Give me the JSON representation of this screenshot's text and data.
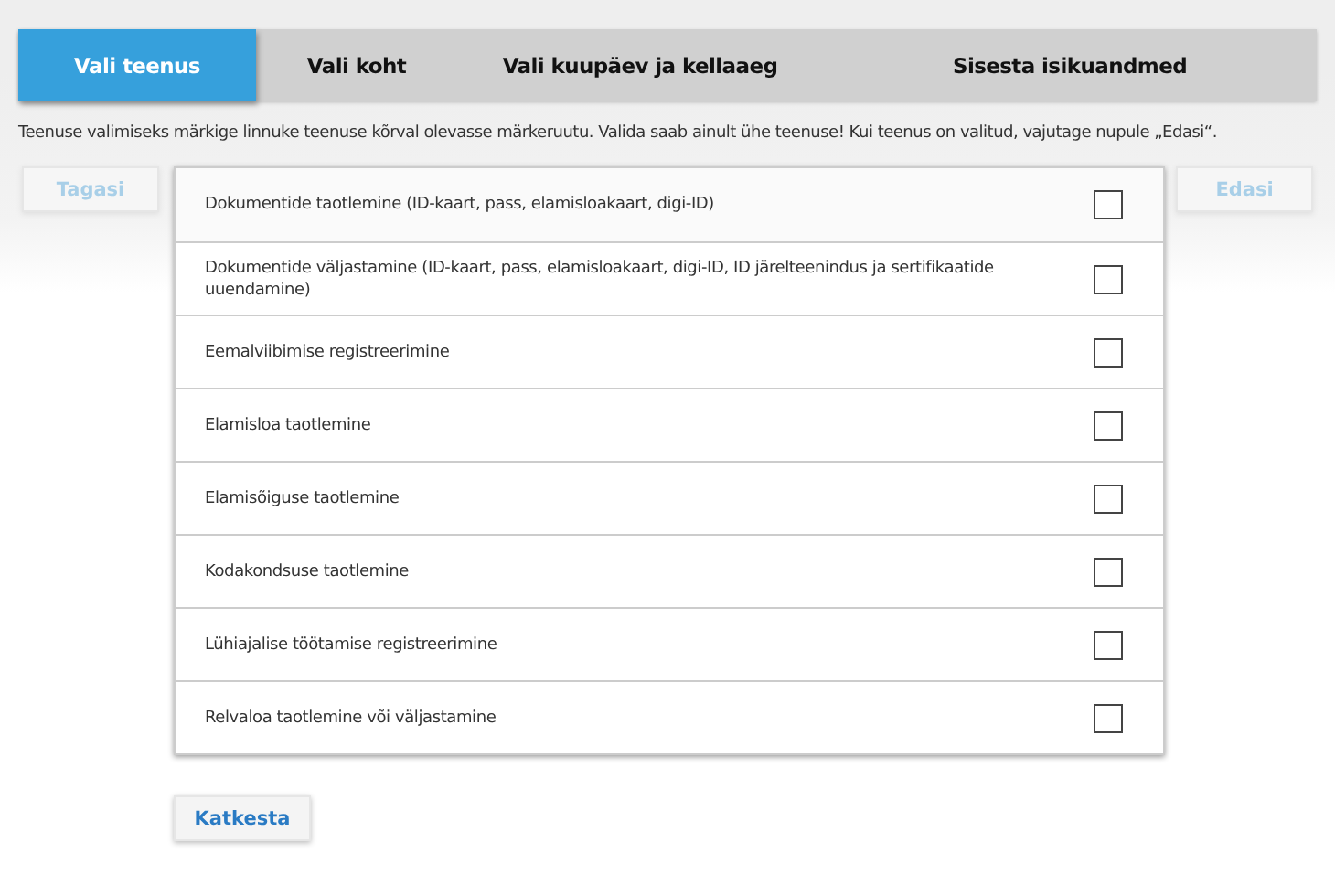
{
  "steps": [
    {
      "label": "Vali teenus",
      "selected": true
    },
    {
      "label": "Vali koht",
      "selected": false
    },
    {
      "label": "Vali kuupäev ja kellaaeg",
      "selected": false
    },
    {
      "label": "Sisesta isikuandmed",
      "selected": false
    }
  ],
  "instruction": "Teenuse valimiseks märkige linnuke teenuse kõrval olevasse märkeruutu. Valida saab ainult ühe teenuse! Kui teenus on valitud, vajutage nupule „Edasi“.",
  "back_button": {
    "label": "Tagasi",
    "disabled": true
  },
  "next_button": {
    "label": "Edasi",
    "disabled": true
  },
  "services": [
    {
      "label": "Dokumentide taotlemine (ID-kaart, pass, elamisloakaart, digi-ID)",
      "checked": false
    },
    {
      "label": "Dokumentide väljastamine (ID-kaart, pass, elamisloakaart, digi-ID, ID järelteenindus ja sertifikaatide uuendamine)",
      "checked": false
    },
    {
      "label": "Eemalviibimise registreerimine",
      "checked": false
    },
    {
      "label": "Elamisloa taotlemine",
      "checked": false
    },
    {
      "label": "Elamisõiguse taotlemine",
      "checked": false
    },
    {
      "label": "Kodakondsuse taotlemine",
      "checked": false
    },
    {
      "label": "Lühiajalise töötamise registreerimine",
      "checked": false
    },
    {
      "label": "Relvaloa taotlemine või väljastamine",
      "checked": false
    }
  ],
  "cancel_button": {
    "label": "Katkesta",
    "disabled": false
  }
}
